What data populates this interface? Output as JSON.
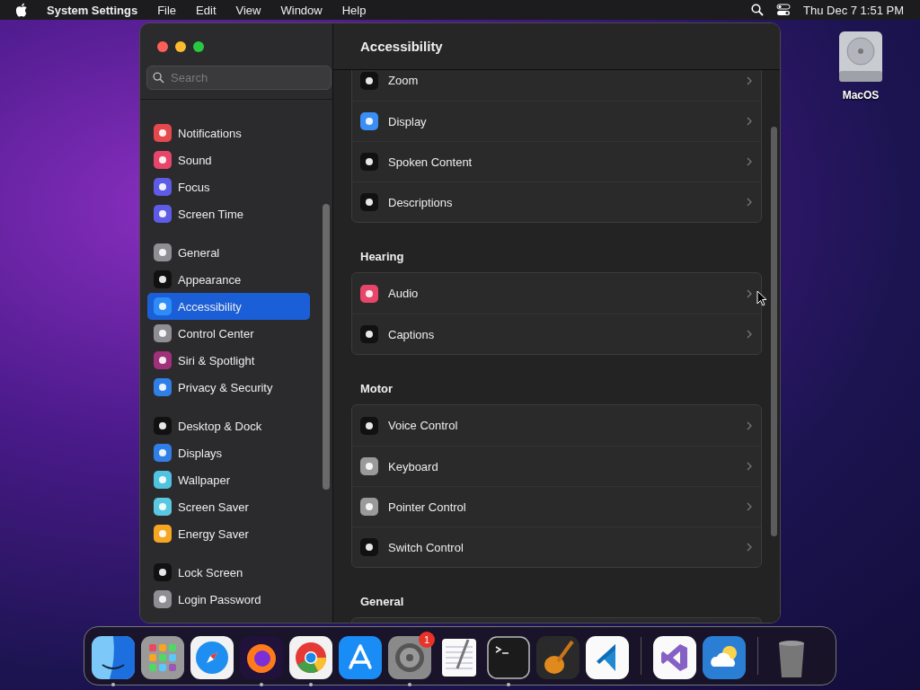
{
  "menu_bar": {
    "app_name": "System Settings",
    "menus": [
      "File",
      "Edit",
      "View",
      "Window",
      "Help"
    ],
    "clock": "Thu Dec 7  1:51 PM"
  },
  "desktop": {
    "disk_label": "MacOS"
  },
  "sidebar": {
    "search": {
      "placeholder": "Search"
    },
    "groups": [
      {
        "items": [
          {
            "label": "Notifications",
            "color": "#e5484d",
            "selected": false
          },
          {
            "label": "Sound",
            "color": "#e8456a",
            "selected": false
          },
          {
            "label": "Focus",
            "color": "#5e5ce6",
            "selected": false
          },
          {
            "label": "Screen Time",
            "color": "#5e5ce6",
            "selected": false
          }
        ]
      },
      {
        "items": [
          {
            "label": "General",
            "color": "#8e8e93",
            "selected": false
          },
          {
            "label": "Appearance",
            "color": "#111111",
            "selected": false
          },
          {
            "label": "Accessibility",
            "color": "#2f8cf7",
            "selected": true
          },
          {
            "label": "Control Center",
            "color": "#8e8e93",
            "selected": false
          },
          {
            "label": "Siri & Spotlight",
            "color": "#a0307a",
            "selected": false
          },
          {
            "label": "Privacy & Security",
            "color": "#2f7fe6",
            "selected": false
          }
        ]
      },
      {
        "items": [
          {
            "label": "Desktop & Dock",
            "color": "#111111",
            "selected": false
          },
          {
            "label": "Displays",
            "color": "#2f7fe6",
            "selected": false
          },
          {
            "label": "Wallpaper",
            "color": "#4fc3e0",
            "selected": false
          },
          {
            "label": "Screen Saver",
            "color": "#5ac8e0",
            "selected": false
          },
          {
            "label": "Energy Saver",
            "color": "#f5a623",
            "selected": false
          }
        ]
      },
      {
        "items": [
          {
            "label": "Lock Screen",
            "color": "#111111",
            "selected": false
          },
          {
            "label": "Login Password",
            "color": "#8e8e93",
            "selected": false
          }
        ]
      }
    ]
  },
  "content": {
    "title": "Accessibility",
    "sections": [
      {
        "rows": [
          {
            "label": "Zoom",
            "color": "#111111"
          },
          {
            "label": "Display",
            "color": "#3a8ef5"
          },
          {
            "label": "Spoken Content",
            "color": "#111111"
          },
          {
            "label": "Descriptions",
            "color": "#111111"
          }
        ]
      },
      {
        "heading": "Hearing",
        "rows": [
          {
            "label": "Audio",
            "color": "#e8456a"
          },
          {
            "label": "Captions",
            "color": "#111111"
          }
        ]
      },
      {
        "heading": "Motor",
        "rows": [
          {
            "label": "Voice Control",
            "color": "#111111"
          },
          {
            "label": "Keyboard",
            "color": "#9a9a9a"
          },
          {
            "label": "Pointer Control",
            "color": "#9a9a9a"
          },
          {
            "label": "Switch Control",
            "color": "#111111"
          }
        ]
      },
      {
        "heading": "General"
      }
    ]
  },
  "dock": {
    "items": [
      {
        "running": true
      },
      {
        "running": false
      },
      {
        "running": false
      },
      {
        "running": true
      },
      {
        "running": true
      },
      {
        "running": false
      },
      {
        "running": true,
        "badge": "1"
      },
      {
        "running": false
      },
      {
        "running": true
      },
      {
        "running": false
      },
      {
        "running": false
      },
      {
        "running": false
      },
      {
        "running": false
      },
      {
        "running": false
      }
    ]
  }
}
